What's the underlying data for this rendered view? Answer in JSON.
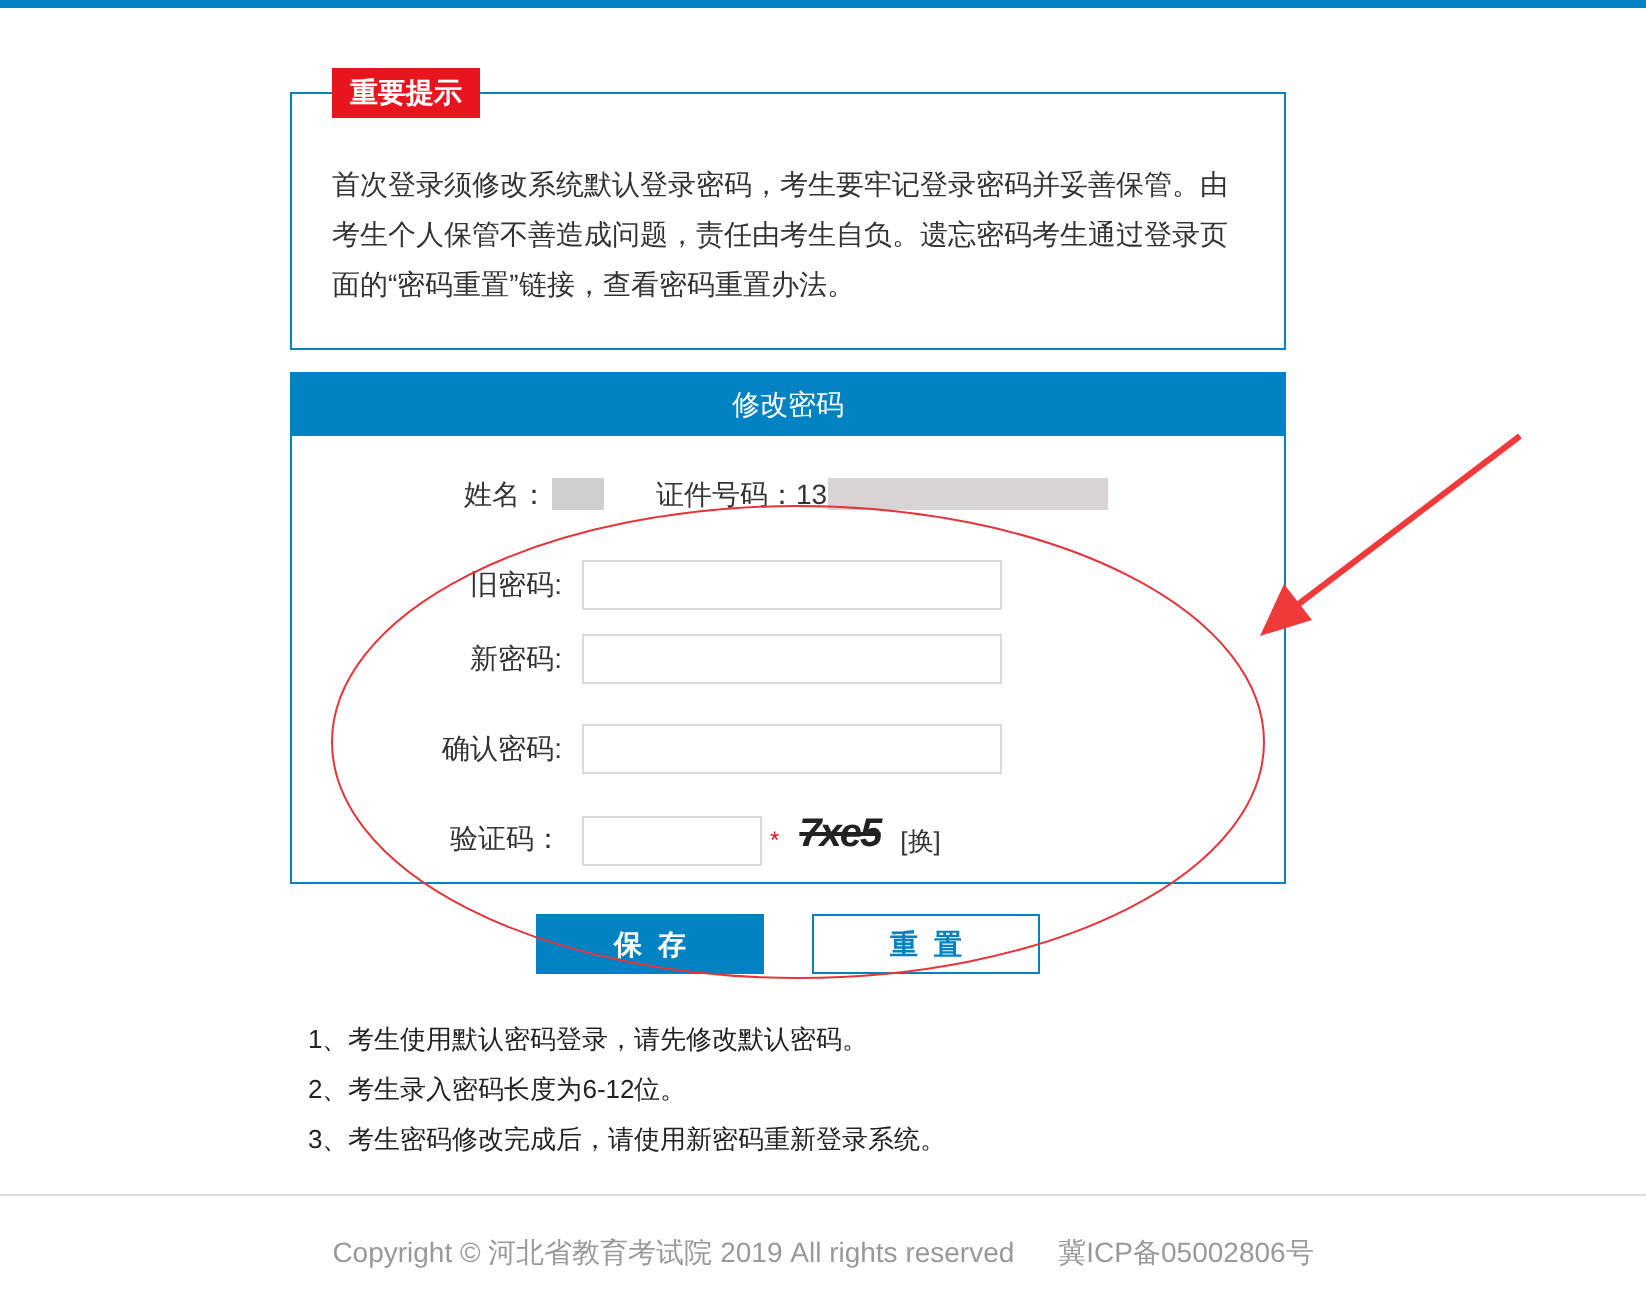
{
  "notice": {
    "badge": "重要提示",
    "text": "首次登录须修改系统默认登录密码，考生要牢记登录密码并妥善保管。由考生个人保管不善造成问题，责任由考生自负。遗忘密码考生通过登录页面的“密码重置”链接，查看密码重置办法。"
  },
  "form": {
    "title": "修改密码",
    "name_label": "姓名：",
    "id_label": "证件号码：13",
    "fields": [
      {
        "label": "旧密码:",
        "kind": "password"
      },
      {
        "label": "新密码:",
        "kind": "password"
      },
      {
        "label": "确认密码:",
        "kind": "password"
      },
      {
        "label": "验证码：",
        "kind": "captcha",
        "required_mark": "*",
        "captcha": "7xe5",
        "refresh": "[换]"
      }
    ]
  },
  "buttons": [
    {
      "label": "保  存",
      "kind": "primary"
    },
    {
      "label": "重  置",
      "kind": "outline"
    }
  ],
  "notes": [
    "1、考生使用默认密码登录，请先修改默认密码。",
    "2、考生录入密码长度为6-12位。",
    "3、考生密码修改完成后，请使用新密码重新登录系统。"
  ],
  "footer": {
    "copyright": "Copyright © 河北省教育考试院 2019 All rights reserved",
    "icp": "冀ICP备05002806号"
  }
}
